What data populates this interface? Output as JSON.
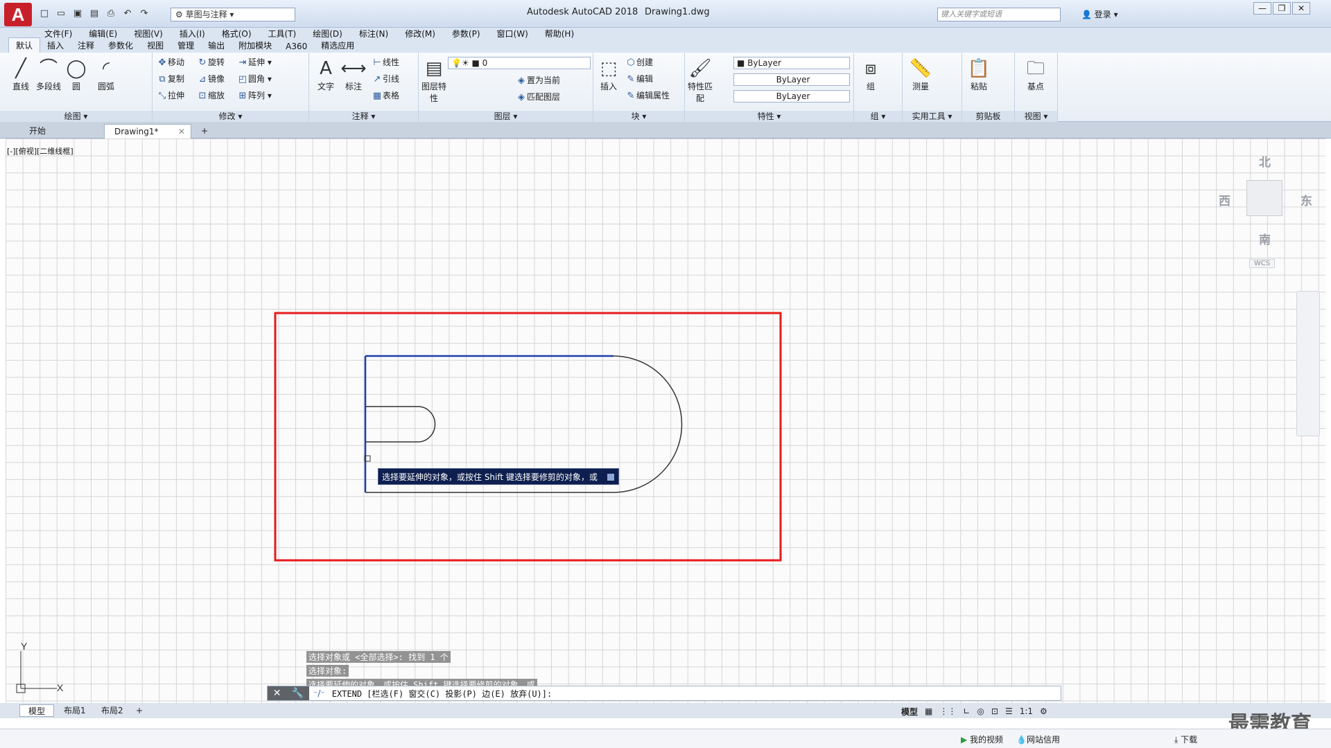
{
  "titlebar": {
    "workspace": "草图与注释",
    "app_title": "Autodesk AutoCAD 2018",
    "doc_title": "Drawing1.dwg",
    "search_placeholder": "键入关键字或短语",
    "login": "登录"
  },
  "menu": [
    "文件(F)",
    "编辑(E)",
    "视图(V)",
    "插入(I)",
    "格式(O)",
    "工具(T)",
    "绘图(D)",
    "标注(N)",
    "修改(M)",
    "参数(P)",
    "窗口(W)",
    "帮助(H)"
  ],
  "ribbon_tabs": [
    "默认",
    "插入",
    "注释",
    "参数化",
    "视图",
    "管理",
    "输出",
    "附加模块",
    "A360",
    "精选应用"
  ],
  "panels": {
    "draw": {
      "title": "绘图",
      "line": "直线",
      "polyline": "多段线",
      "circle": "圆",
      "arc": "圆弧"
    },
    "modify": {
      "title": "修改",
      "move": "移动",
      "rotate": "旋转",
      "extend": "延伸",
      "copy": "复制",
      "mirror": "镜像",
      "fillet": "圆角",
      "stretch": "拉伸",
      "scale": "缩放",
      "array": "阵列"
    },
    "annotation": {
      "title": "注释",
      "text": "文字",
      "dim": "标注",
      "linear": "线性",
      "leader": "引线",
      "table": "表格"
    },
    "layers": {
      "title": "图层",
      "props": "图层特性",
      "layer_value": "0",
      "set_current": "置为当前",
      "match": "匹配图层"
    },
    "block": {
      "title": "块",
      "insert": "插入",
      "create": "创建",
      "edit": "编辑",
      "edit_attr": "编辑属性"
    },
    "properties": {
      "title": "特性",
      "match": "特性匹配",
      "color": "ByLayer",
      "linetype": "ByLayer",
      "lineweight": "ByLayer"
    },
    "groups": {
      "title": "组",
      "group": "组"
    },
    "utilities": {
      "title": "实用工具",
      "measure": "测量"
    },
    "clipboard": {
      "title": "剪贴板",
      "paste": "粘贴"
    },
    "view": {
      "title": "视图",
      "base": "基点"
    }
  },
  "doctabs": {
    "start": "开始",
    "drawing": "Drawing1*"
  },
  "viewport_label": "[-][俯视][二维线框]",
  "viewcube": {
    "north": "北",
    "south": "南",
    "east": "东",
    "west": "西",
    "wcs": "WCS"
  },
  "tooltip": "选择要延伸的对象，或按住 Shift 键选择要修剪的对象，或",
  "command_history": [
    "选择对象或 <全部选择>:  找到 1 个",
    "选择对象:",
    "选择要延伸的对象，或按住 Shift 键选择要修剪的对象，或"
  ],
  "command_line": "EXTEND [栏选(F) 窗交(C) 投影(P) 边(E) 放弃(U)]:",
  "layout_tabs": [
    "模型",
    "布局1",
    "布局2"
  ],
  "status": {
    "model": "模型",
    "scale": "1:1"
  },
  "taskbar": {
    "video": "我的视频",
    "web": "网站信用",
    "download": "下载"
  },
  "watermark": "最需教育",
  "colors": {
    "highlight_rect": "#e8191c",
    "selected_edge": "#1e3ea8",
    "geometry": "#333333"
  }
}
